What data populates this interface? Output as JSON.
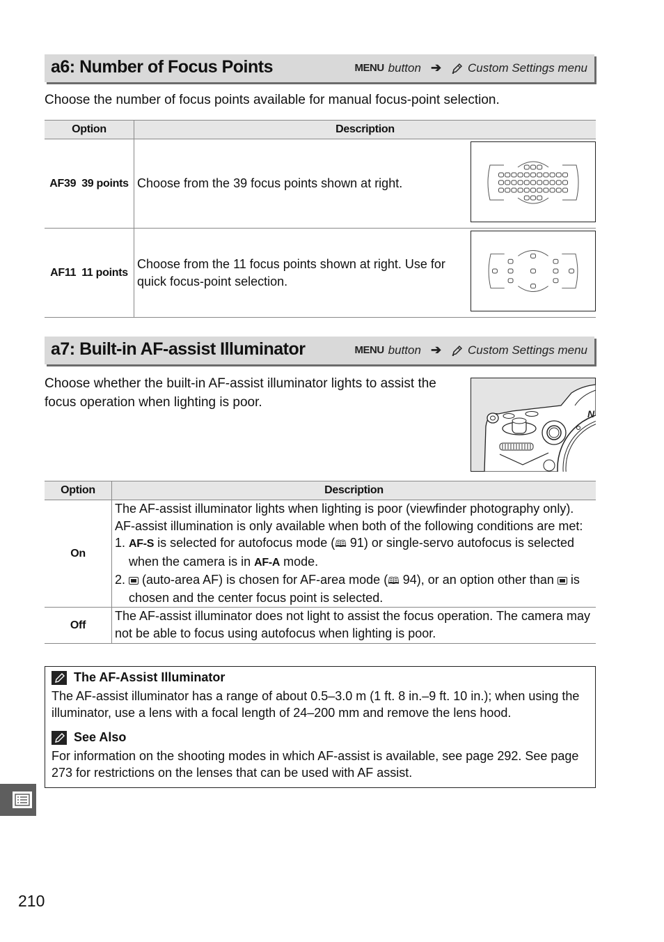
{
  "sections": {
    "a6": {
      "title": "a6: Number of Focus Points",
      "path": {
        "menu_label": "MENU",
        "button_text": "button",
        "arrow": "➔",
        "menu_name": "Custom Settings menu",
        "icon": "pencil-icon"
      },
      "lead": "Choose the number of focus points available for manual focus-point selection.",
      "table": {
        "headers": [
          "Option",
          "Description"
        ],
        "rows": [
          {
            "icon_label": "AF39",
            "option": "39 points",
            "description": "Choose from the 39 focus points shown at right.",
            "diagram": "39-point-af-diagram"
          },
          {
            "icon_label": "AF11",
            "option": "11 points",
            "description": "Choose from the 11 focus points shown at right.  Use for quick focus-point selection.",
            "diagram": "11-point-af-diagram"
          }
        ]
      }
    },
    "a7": {
      "title": "a7: Built-in AF-assist Illuminator",
      "path": {
        "menu_label": "MENU",
        "button_text": "button",
        "arrow": "➔",
        "menu_name": "Custom Settings menu",
        "icon": "pencil-icon"
      },
      "lead": "Choose whether the built-in AF-assist illuminator lights to assist the focus operation when lighting is poor.",
      "illustration": "camera-af-assist-illustration",
      "table": {
        "headers": [
          "Option",
          "Description"
        ],
        "rows": [
          {
            "option": "On",
            "intro": "The AF-assist illuminator lights when lighting is poor (viewfinder photography only).  AF-assist illumination is only available when both of the following conditions are met:",
            "items": [
              {
                "num": "1.",
                "key1": "AF-S",
                "t1": " is selected for autofocus mode (",
                "ref1": "91",
                "t2": ") or single-servo autofocus is selected when the camera is in ",
                "key2": "AF-A",
                "t3": " mode."
              },
              {
                "num": "2.",
                "t1": " (auto-area AF) is chosen for AF-area mode (",
                "ref1": "94",
                "t2": "), or an option other than ",
                "t3": " is chosen and the center focus point is selected."
              }
            ]
          },
          {
            "option": "Off",
            "description": "The AF-assist illuminator does not light to assist the focus operation.  The camera may not be able to focus using autofocus when lighting is poor."
          }
        ]
      }
    }
  },
  "notes": [
    {
      "title": "The AF-Assist Illuminator",
      "body": "The AF-assist illuminator has a range of about 0.5–3.0 m (1 ft. 8 in.–9 ft. 10 in.); when using the illuminator, use a lens with a focal length of 24–200 mm and remove the lens hood."
    },
    {
      "title": "See Also",
      "body": "For information on the shooting modes in which AF-assist is available, see page 292.  See page 273 for restrictions on the lenses that can be used with AF assist."
    }
  ],
  "book_glyph": "🕮",
  "side_tab_icon": "menu-list-icon",
  "page_number": "210"
}
